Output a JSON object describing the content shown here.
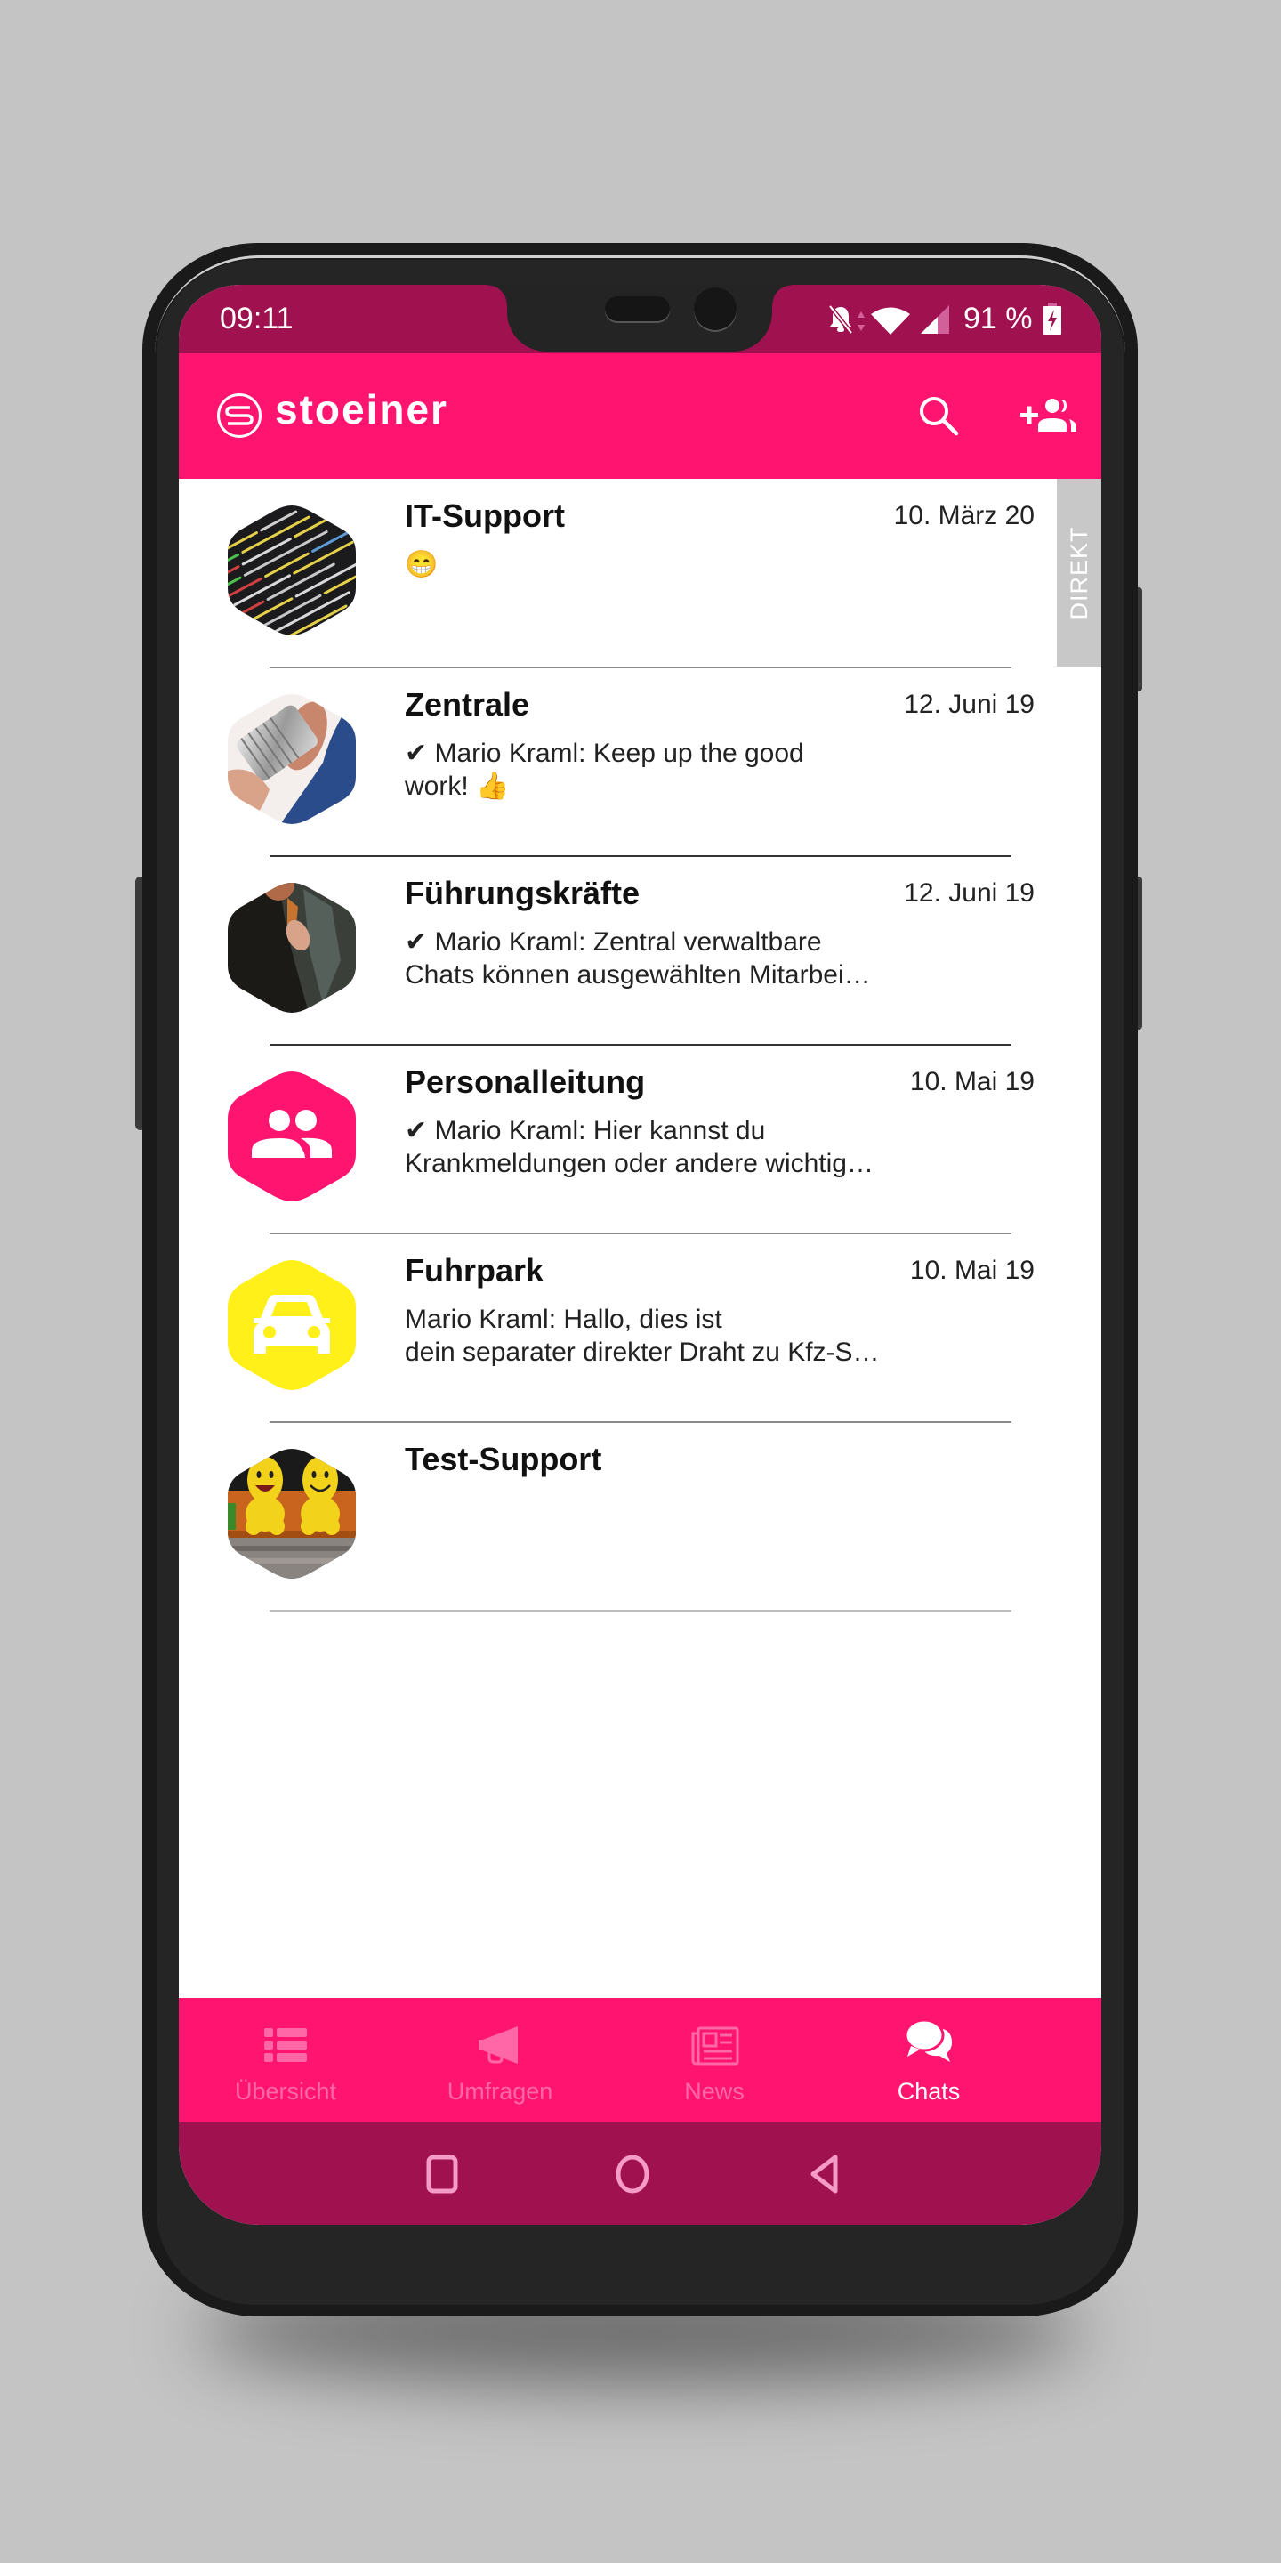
{
  "colors": {
    "brand": "#ff1570",
    "status_bar": "#a0124f",
    "nav_inactive": "#ff67a6",
    "nav_active": "#ffffff",
    "direkt_tab": "#c8c8c8",
    "fuhrpark_avatar": "#fff01a",
    "personalleitung_avatar": "#ff1570"
  },
  "status_bar": {
    "time": "09:11",
    "battery": "91 %",
    "icons": [
      "notifications-off-icon",
      "wifi-icon",
      "signal-icon",
      "battery-charging-icon"
    ]
  },
  "app_bar": {
    "logo_text": "stoeiner",
    "actions": [
      {
        "name": "search",
        "icon": "search-icon"
      },
      {
        "name": "add-group",
        "icon": "group-add-icon"
      }
    ]
  },
  "side_tab": {
    "label": "DIREKT"
  },
  "chats": [
    {
      "title": "IT-Support",
      "date": "10. März 20",
      "preview_lines": [
        "😁"
      ],
      "avatar": "photo-code-screen"
    },
    {
      "title": "Zentrale",
      "date": "12. Juni 19",
      "preview_lines": [
        "✔ Mario Kraml: Keep up the good",
        "work! 👍"
      ],
      "avatar": "photo-tin-can-phone"
    },
    {
      "title": "Führungskräfte",
      "date": "12. Juni 19",
      "preview_lines": [
        "✔ Mario Kraml: Zentral verwaltbare",
        "Chats können ausgewählten Mitarbei…"
      ],
      "avatar": "photo-business-tie"
    },
    {
      "title": "Personalleitung",
      "date": "10. Mai 19",
      "preview_lines": [
        "✔ Mario Kraml: Hier kannst du",
        "Krankmeldungen oder andere wichtig…"
      ],
      "avatar": "people-icon"
    },
    {
      "title": "Fuhrpark",
      "date": "10. Mai 19",
      "preview_lines": [
        "Mario Kraml: Hallo, dies ist",
        "dein separater direkter Draht zu Kfz-S…"
      ],
      "avatar": "car-icon"
    },
    {
      "title": "Test-Support",
      "date": "",
      "preview_lines": [],
      "avatar": "photo-smiley-plushies"
    }
  ],
  "bottom_nav": {
    "items": [
      {
        "label": "Übersicht",
        "icon": "list-icon",
        "active": false
      },
      {
        "label": "Umfragen",
        "icon": "megaphone-icon",
        "active": false
      },
      {
        "label": "News",
        "icon": "newspaper-icon",
        "active": false
      },
      {
        "label": "Chats",
        "icon": "chat-bubbles-icon",
        "active": true
      }
    ]
  },
  "system_nav": {
    "buttons": [
      "recents",
      "home",
      "back"
    ]
  }
}
